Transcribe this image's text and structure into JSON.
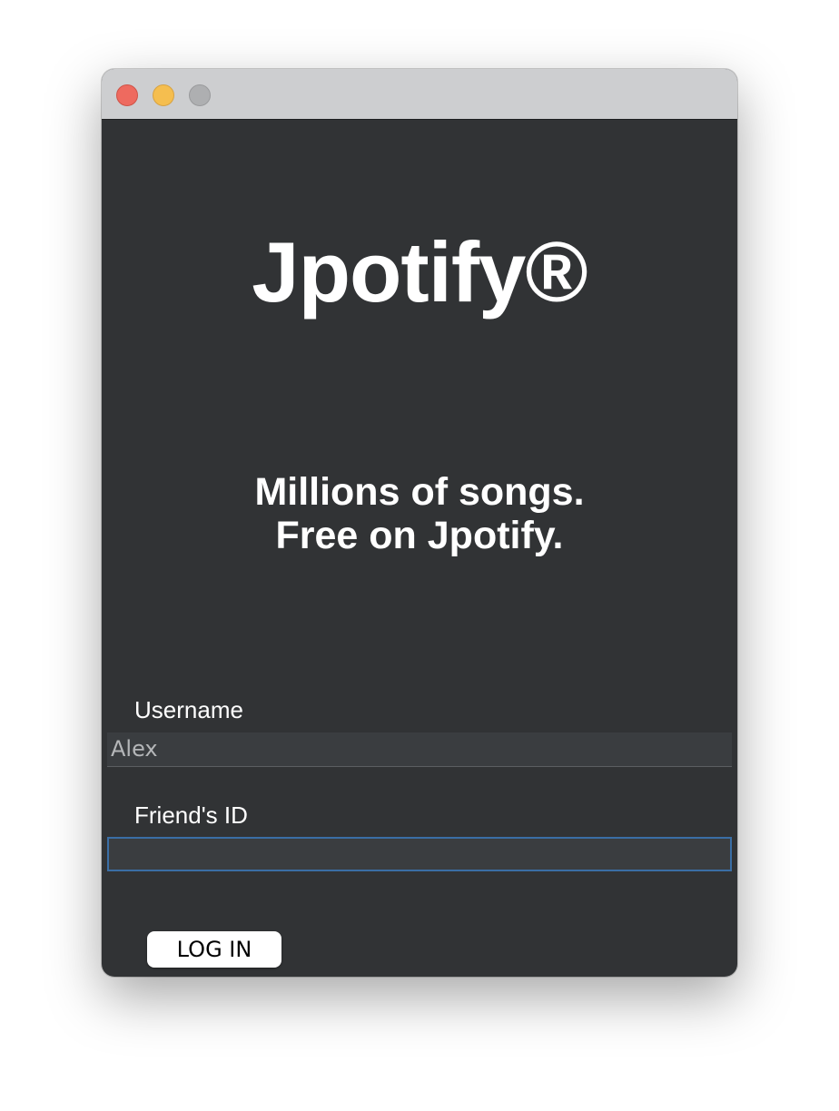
{
  "window": {
    "controls": {
      "close": {
        "icon": "close-dot-icon",
        "color": "#ee6a5f"
      },
      "minimize": {
        "icon": "minimize-dot-icon",
        "color": "#f5be4f"
      },
      "zoom": {
        "icon": "zoom-dot-icon",
        "color": "#aeafb1"
      }
    },
    "background_color": "#313335"
  },
  "app": {
    "title": "Jpotify®",
    "tagline_line1": "Millions of songs.",
    "tagline_line2": "Free on Jpotify."
  },
  "form": {
    "username_label": "Username",
    "username_value": "Alex",
    "friend_id_label": "Friend's ID",
    "friend_id_value": "",
    "login_label": "LOG IN"
  },
  "colors": {
    "focus_border": "#3a6ea5",
    "field_background": "#3a3d40",
    "text": "#ffffff"
  }
}
